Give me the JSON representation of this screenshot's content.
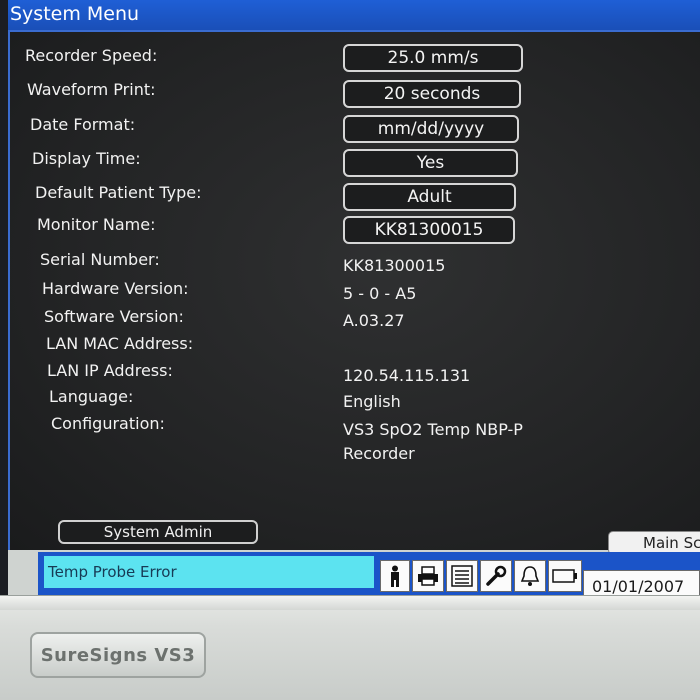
{
  "window": {
    "title": "System Menu"
  },
  "settings": [
    {
      "label": "Recorder Speed:",
      "value": "25.0 mm/s"
    },
    {
      "label": "Waveform Print:",
      "value": "20 seconds"
    },
    {
      "label": "Date Format:",
      "value": "mm/dd/yyyy"
    },
    {
      "label": "Display Time:",
      "value": "Yes"
    },
    {
      "label": "Default Patient Type:",
      "value": "Adult"
    },
    {
      "label": "Monitor Name:",
      "value": "KK81300015"
    }
  ],
  "info": [
    {
      "label": "Serial Number:",
      "value": "KK81300015"
    },
    {
      "label": "Hardware Version:",
      "value": "5 - 0 - A5"
    },
    {
      "label": "Software Version:",
      "value": "A.03.27"
    },
    {
      "label": "LAN MAC Address:",
      "value": ""
    },
    {
      "label": "LAN IP Address:",
      "value": "120.54.115.131"
    },
    {
      "label": "Language:",
      "value": "English"
    },
    {
      "label": "Configuration:",
      "value": "VS3 SpO2 Temp NBP-P",
      "value2": "Recorder"
    }
  ],
  "buttons": {
    "system_admin": "System Admin",
    "main_screen": "Main Sc"
  },
  "status": {
    "alarm_message": "Temp Probe Error",
    "date": "01/01/2007",
    "icons": [
      "patient-icon",
      "print-icon",
      "report-icon",
      "wrench-icon",
      "alarm-bell-icon",
      "battery-icon"
    ]
  },
  "device": {
    "brand": "SureSigns VS3"
  },
  "colors": {
    "title_bar": "#1f5fd6",
    "alarm_bg": "#5ce3f0",
    "panel_bg": "#232425"
  }
}
